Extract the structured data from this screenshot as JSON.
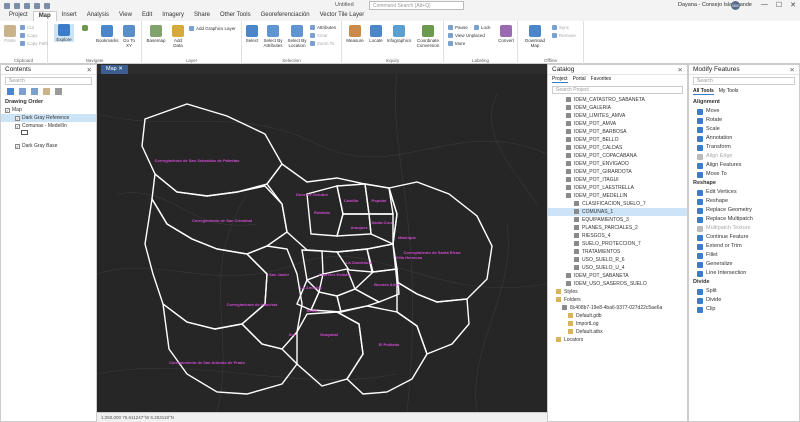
{
  "titlebar": {
    "title": "Untitled",
    "search_placeholder": "Command Search (Alt+Q)",
    "user": "Dayana - Consejo Isla Grande",
    "avatar": "DM",
    "min": "—",
    "max": "☐",
    "close": "✕"
  },
  "tabs": [
    "Project",
    "Map",
    "Insert",
    "Analysis",
    "View",
    "Edit",
    "Imagery",
    "Share",
    "Other Tools",
    "Georeferenciación",
    "Vector Tile Layer"
  ],
  "ribbon": {
    "clipboard": {
      "label": "Clipboard",
      "paste": "Paste",
      "cut": "Cut",
      "copy": "Copy",
      "copy_path": "Copy Path"
    },
    "navigate": {
      "label": "Navigate",
      "explore": "Explore",
      "bookmarks": "Bookmarks",
      "goto": "Go To XY"
    },
    "layer": {
      "label": "Layer",
      "basemap": "Basemap",
      "add_data": "Add Data",
      "add_graphics": "Add Graphics Layer"
    },
    "selection": {
      "label": "Selection",
      "select": "Select",
      "by_attr": "Select By Attributes",
      "by_loc": "Select By Location",
      "attributes": "Attributes",
      "clear": "Clear",
      "zoom": "Zoom To"
    },
    "inquiry": {
      "label": "Inquiry",
      "measure": "Measure",
      "locate": "Locate",
      "infographics": "Infographics",
      "coord": "Coordinate Conversion"
    },
    "labeling": {
      "label": "Labeling",
      "pause": "Pause",
      "lock": "Lock",
      "view_unplaced": "View Unplaced",
      "more": "More",
      "convert": "Convert"
    },
    "offline": {
      "label": "Offline",
      "download": "Download Map",
      "sync": "Sync",
      "remove": "Remove"
    }
  },
  "contents": {
    "title": "Contents",
    "search": "Search",
    "drawing_order": "Drawing Order",
    "items": [
      "Map",
      "Dark Gray Reference",
      "Comunas - Medellín",
      "Dark Gray Base"
    ]
  },
  "map": {
    "tab": "Map",
    "status": "1:250,000",
    "coords": "75.611247°W 6.253118°N",
    "labels": [
      "Corregimiento de San Sebastián de Palmitas",
      "Corregimiento de San Cristóbal",
      "Corregimiento de Santa Elena",
      "Corregimiento de Altavista",
      "Corregimiento de San Antonio de Prado",
      "Robledo",
      "Castilla",
      "Popular",
      "Santa Cruz",
      "Manrique",
      "Aranjuez",
      "Doce de Octubre",
      "Villa Hermosa",
      "Buenos Aires",
      "Laureles Estadio",
      "La América",
      "San Javier",
      "La Candelaria",
      "Guayabal",
      "Belén",
      "El Poblado",
      "Sur"
    ]
  },
  "catalog": {
    "title": "Catalog",
    "tabs": [
      "Project",
      "Portal",
      "Favorites"
    ],
    "search": "Search Project",
    "items": [
      "IDEM_CATASTRO_SABANETA",
      "IDEM_GALERIA",
      "IDEM_LIMITES_AMVA",
      "IDEM_POT_AMVA",
      "IDEM_POT_BARBOSA",
      "IDEM_POT_BELLO",
      "IDEM_POT_CALDAS",
      "IDEM_POT_COPACABANA",
      "IDEM_POT_ENVIGADO",
      "IDEM_POT_GIRARDOTA",
      "IDEM_POT_ITAGUI",
      "IDEM_POT_LAESTRELLA",
      "IDEM_POT_MEDELLIN",
      "CLASIFICACION_SUELO_7",
      "COMUNAS_1",
      "EQUIPAMIENTOS_3",
      "PLANES_PARCIALES_2",
      "RIESGOS_4",
      "SUELO_PROTECCION_7",
      "TRATAMIENTOS",
      "USO_SUELO_R_6",
      "USO_SUELO_U_4",
      "IDEM_POT_SABANETA",
      "IDEM_USO_SASEROS_SUELO",
      "Styles",
      "Folders",
      "8c408b7-19e8-4ba6-9377-027d22c5ae6a",
      "Default.gdb",
      "ImportLog",
      "Default.atbx",
      "Locators"
    ]
  },
  "modify": {
    "title": "Modify Features",
    "search": "Search",
    "tabs": [
      "All Tools",
      "My Tools"
    ],
    "alignment": "Alignment",
    "reshape": "Reshape",
    "divide": "Divide",
    "tools": [
      {
        "n": "Move",
        "d": false
      },
      {
        "n": "Rotate",
        "d": false
      },
      {
        "n": "Scale",
        "d": false
      },
      {
        "n": "Annotation",
        "d": false
      },
      {
        "n": "Transform",
        "d": false
      },
      {
        "n": "Align Edge",
        "d": true
      },
      {
        "n": "Align Features",
        "d": false
      },
      {
        "n": "Move To",
        "d": false
      }
    ],
    "reshape_tools": [
      {
        "n": "Edit Vertices",
        "d": false
      },
      {
        "n": "Reshape",
        "d": false
      },
      {
        "n": "Replace Geometry",
        "d": false
      },
      {
        "n": "Replace Multipatch",
        "d": false
      },
      {
        "n": "Multipatch Texture",
        "d": true
      },
      {
        "n": "Continue Feature",
        "d": false
      },
      {
        "n": "Extend or Trim",
        "d": false
      },
      {
        "n": "Fillet",
        "d": false
      },
      {
        "n": "Generalize",
        "d": false
      },
      {
        "n": "Line Intersection",
        "d": false
      }
    ],
    "divide_tools": [
      {
        "n": "Split",
        "d": false
      },
      {
        "n": "Divide",
        "d": false
      },
      {
        "n": "Clip",
        "d": false
      }
    ]
  }
}
